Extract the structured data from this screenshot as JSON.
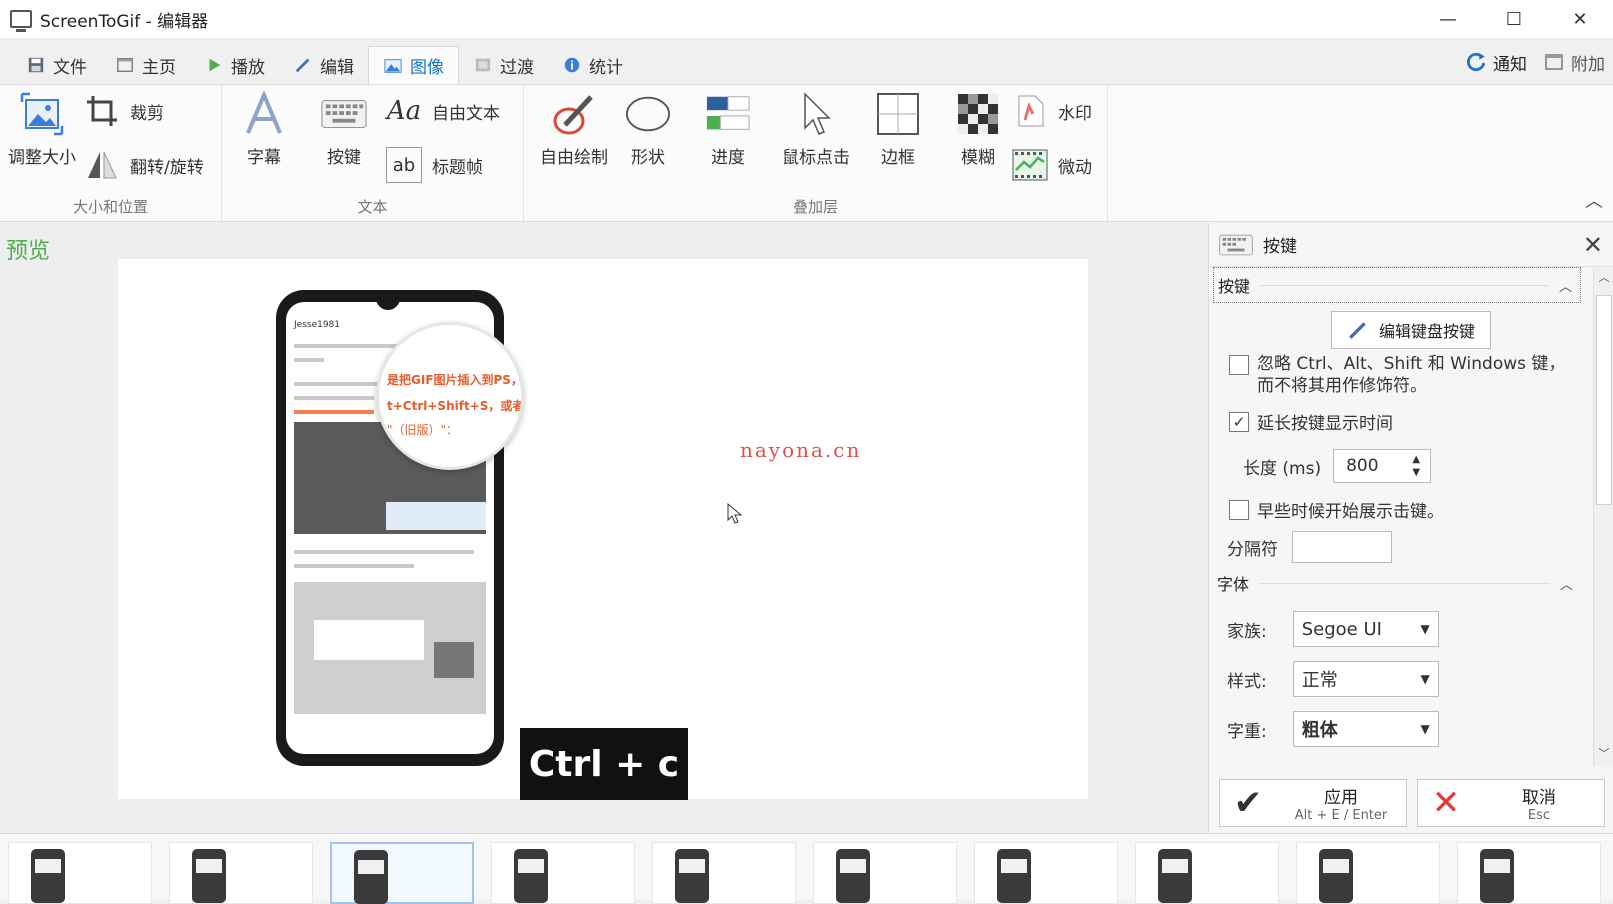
{
  "window": {
    "title": "ScreenToGif - 编辑器",
    "minimize": "—",
    "maximize": "☐",
    "close": "✕"
  },
  "tabs": [
    {
      "label": "文件",
      "icon": "save-icon"
    },
    {
      "label": "主页",
      "icon": "home-icon"
    },
    {
      "label": "播放",
      "icon": "play-icon"
    },
    {
      "label": "编辑",
      "icon": "pencil-icon"
    },
    {
      "label": "图像",
      "icon": "image-icon",
      "active": true
    },
    {
      "label": "过渡",
      "icon": "transition-icon"
    },
    {
      "label": "统计",
      "icon": "info-icon"
    }
  ],
  "tabs_right": {
    "notify": "通知",
    "extras": "附加"
  },
  "ribbon": {
    "size_group": {
      "label": "大小和位置",
      "resize": "调整大小",
      "crop": "裁剪",
      "flip": "翻转/旋转"
    },
    "text_group": {
      "label": "文本",
      "caption": "字幕",
      "keystrokes": "按键",
      "free_text": "自由文本",
      "title_frame": "标题帧"
    },
    "overlay_group": {
      "label": "叠加层",
      "free_drawing": "自由绘制",
      "shapes": "形状",
      "progress": "进度",
      "mouse_clicks": "鼠标点击",
      "border": "边框",
      "blur": "模糊",
      "watermark": "水印",
      "cinemagraph": "微动"
    }
  },
  "preview": {
    "label": "预览",
    "overlay_text": "nayona.cn",
    "key_overlay": "Ctrl + c",
    "magnifier_lines": [
      "是把GIF图片插入到PS，",
      "t+Ctrl+Shift+S，或者点",
      "\"（旧版）\"："
    ],
    "phone_header": "Jesse1981"
  },
  "panel": {
    "title": "按键",
    "keys_section": "按键",
    "edit_keys_button": "编辑键盘按键",
    "ignore_modifiers": "忽略 Ctrl、Alt、Shift 和 Windows 键，而不将其用作修饰符。",
    "ignore_modifiers_checked": false,
    "extend_display": "延长按键显示时间",
    "extend_display_checked": true,
    "length_label": "长度 (ms)",
    "length_value": "800",
    "earlier_display": "早些时候开始展示击键。",
    "earlier_display_checked": false,
    "separator_label": "分隔符",
    "separator_value": "",
    "font_section": "字体",
    "family_label": "家族:",
    "family_value": "Segoe UI",
    "style_label": "样式:",
    "style_value": "正常",
    "weight_label": "字重:",
    "weight_value": "粗体",
    "apply": {
      "label": "应用",
      "shortcut": "Alt + E / Enter"
    },
    "cancel": {
      "label": "取消",
      "shortcut": "Esc"
    }
  },
  "filmstrip": {
    "frame_count": 10,
    "selected_index": 2
  },
  "colors": {
    "accent": "#1a73c8",
    "preview_label": "#4caf50",
    "watermark": "#e05050",
    "apply_check": "#333333",
    "cancel_x": "#e53935"
  }
}
